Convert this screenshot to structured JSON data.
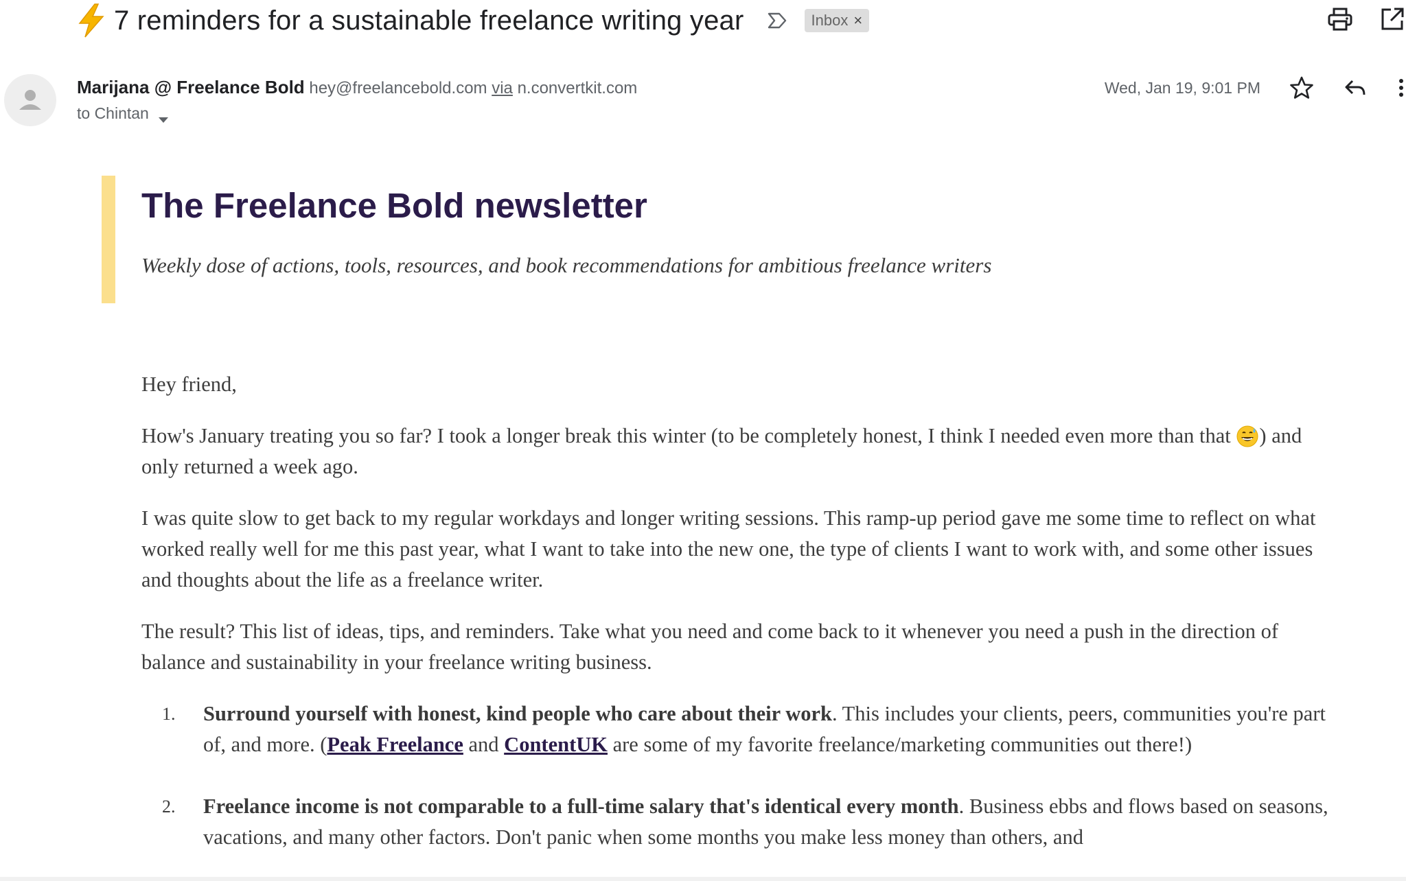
{
  "email": {
    "subject": "7 reminders for a sustainable freelance writing year",
    "label_chip": "Inbox",
    "label_close": "×",
    "sender_name": "Marijana @ Freelance Bold",
    "sender_email": "hey@freelancebold.com",
    "via_word": "via",
    "via_domain": "n.convertkit.com",
    "recipient": "to Chintan",
    "date": "Wed, Jan 19, 9:01 PM"
  },
  "icons": {
    "subject": "lightning-bolt-emoji",
    "important": "important-marker-icon",
    "print": "print-icon",
    "open_new_window": "open-in-new-window-icon",
    "avatar": "default-avatar-icon",
    "star": "star-icon",
    "reply": "reply-icon",
    "more": "more-vertical-icon",
    "caret": "caret-down-icon",
    "emoji_sweat_smile": "grinning-sweat-emoji"
  },
  "colors": {
    "accent_bar": "#fbdf8d",
    "title": "#2b1c4a",
    "chip_bg": "#dddddd"
  },
  "newsletter": {
    "title": "The Freelance Bold newsletter",
    "tagline": "Weekly dose of actions, tools, resources, and book recommendations for ambitious freelance writers",
    "greeting": "Hey friend,",
    "p1_before_emoji": "How's January treating you so far? I took a longer break this winter (to be completely honest, I think I needed even more than that ",
    "p1_after_emoji": ") and only returned a week ago.",
    "p2": "I was quite slow to get back to my regular workdays and longer writing sessions. This ramp-up period gave me some time to reflect on what worked really well for me this past year, what I want to take into the new one, the type of clients I want to work with, and some other issues and thoughts about the life as a freelance writer.",
    "p3": "The result? This list of ideas, tips, and reminders. Take what you need and come back to it whenever you need a push in the direction of balance and sustainability in your freelance writing business.",
    "list": [
      {
        "num": "1.",
        "bold": "Surround yourself with honest, kind people who care about their work",
        "text_a": ". This includes your clients, peers, communities you're part of, and more. (",
        "link1": "Peak Freelance",
        "text_b": " and ",
        "link2": "ContentUK",
        "text_c": " are some of my favorite freelance/marketing communities out there!)"
      },
      {
        "num": "2.",
        "bold": "Freelance income is not comparable to a full-time salary that's identical every month",
        "text_a": ". Business ebbs and flows based on seasons, vacations, and many other factors. Don't panic when some months you make less money than others, and"
      }
    ]
  }
}
